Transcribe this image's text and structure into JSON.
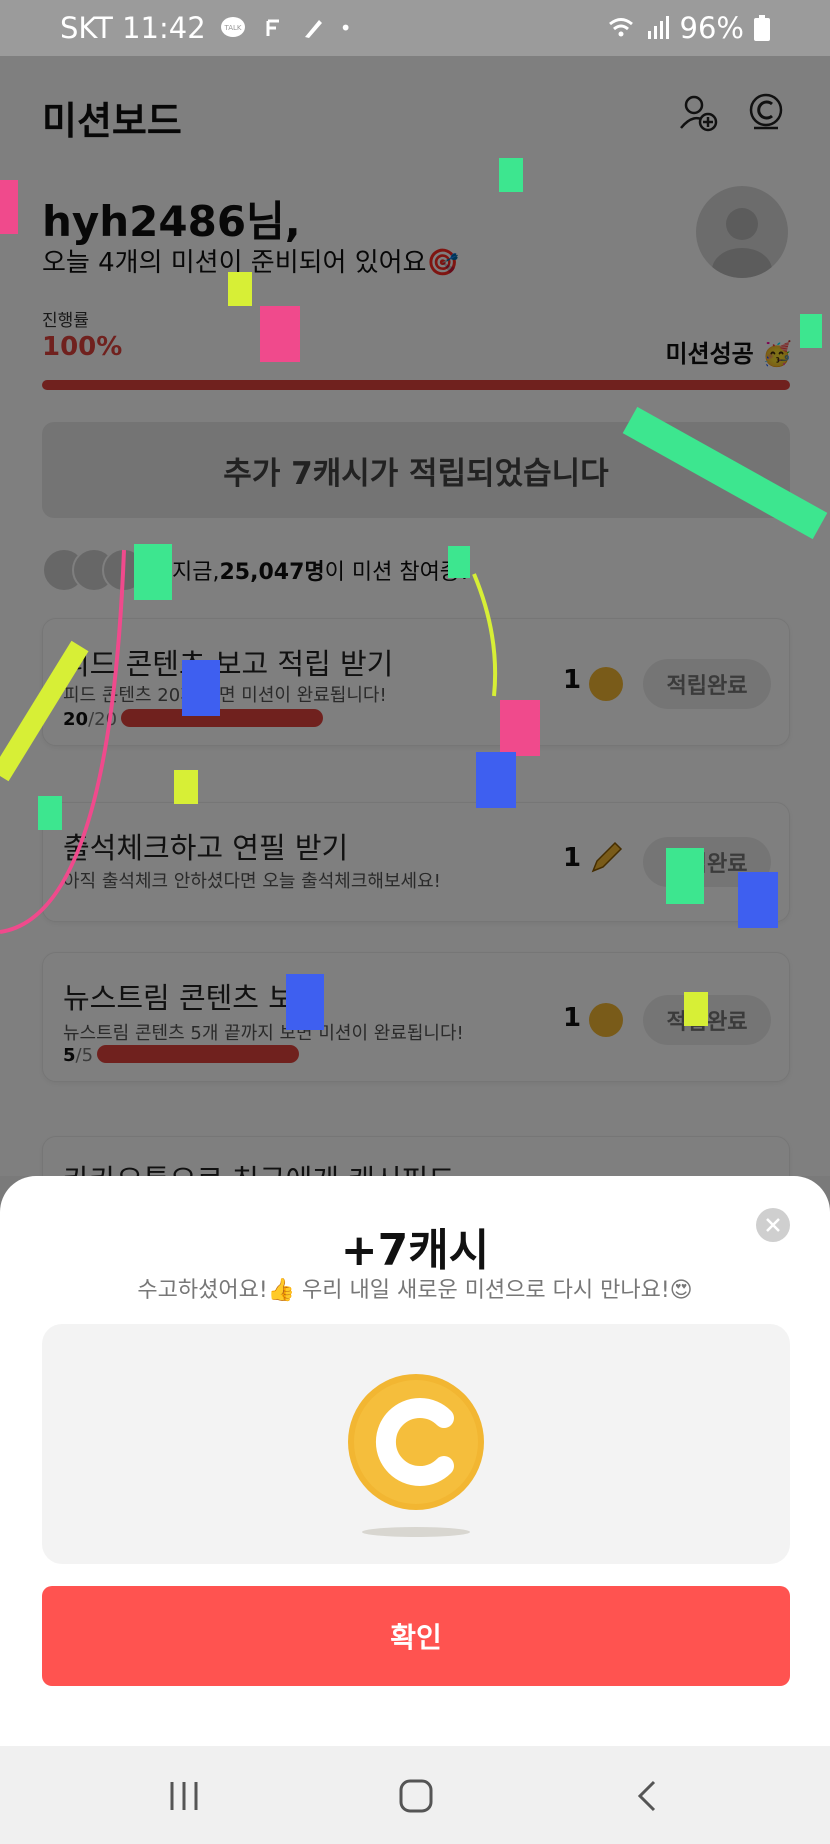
{
  "status_bar": {
    "carrier_time": "SKT 11:42",
    "battery": "96%",
    "talk_badge": "TALK"
  },
  "header": {
    "title": "미션보드",
    "icons": [
      "add-friend-icon",
      "coin-history-icon"
    ]
  },
  "greeting": {
    "name": "hyh2486님,",
    "subtitle": "오늘 4개의 미션이 준비되어 있어요🎯"
  },
  "progress": {
    "label": "진행률",
    "value": "100%",
    "fraction": 1.0,
    "status": "미션성공 🥳"
  },
  "banner": {
    "text": "추가 7캐시가 적립되었습니다"
  },
  "participants": {
    "prefix": "지금, ",
    "count": "25,047명",
    "suffix": "이 미션 참여중!"
  },
  "missions": [
    {
      "title": "피드 콘텐츠 보고 적립 받기",
      "subtitle": "피드 콘텐츠 20개 보면 미션이 완료됩니다!",
      "count_done": "20",
      "count_total": "/20",
      "progress": 1.0,
      "reward": "1",
      "reward_icon": "coin-icon",
      "button": "적립완료"
    },
    {
      "title": "출석체크하고 연필 받기",
      "subtitle": "아직 출석체크 안하셨다면 오늘 출석체크해보세요!",
      "reward": "1",
      "reward_icon": "pencil-icon",
      "button": "적립완료"
    },
    {
      "title": "뉴스트림 콘텐츠 보기",
      "subtitle": "뉴스트림 콘텐츠 5개 끝까지 보면 미션이 완료됩니다!",
      "count_done": "5",
      "count_total": "/5",
      "progress": 1.0,
      "reward": "1",
      "reward_icon": "coin-icon",
      "button": "적립완료"
    },
    {
      "title": "카카오톡으로 친구에게 캐시피드"
    }
  ],
  "sheet": {
    "title": "+7캐시",
    "subtitle": "수고하셨어요!👍 우리 내일 새로운 미션으로 다시 만나요!😍",
    "confirm_label": "확인"
  },
  "colors": {
    "accent_red": "#ff5350",
    "progress_red": "#e0433c",
    "coin_gold": "#f2b632"
  },
  "nav": {
    "buttons": [
      "recent-apps-icon",
      "home-icon",
      "back-icon"
    ]
  }
}
